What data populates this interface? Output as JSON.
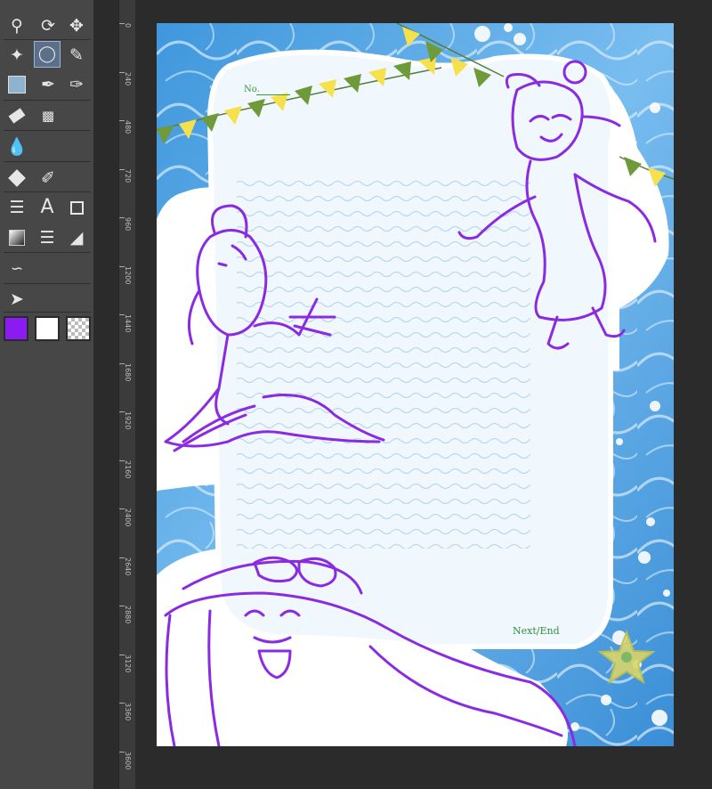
{
  "palette": {
    "tools": [
      {
        "name": "zoom-tool",
        "icon": "magnifier-icon"
      },
      {
        "name": "rotate-tool",
        "icon": "rotate-icon"
      },
      {
        "name": "move-tool",
        "icon": "move-arrows-icon"
      },
      {
        "name": "auto-select-tool",
        "icon": "magic-wand-icon"
      },
      {
        "name": "lasso-select-tool",
        "icon": "lasso-icon",
        "active": true
      },
      {
        "name": "eyedropper-tool",
        "icon": "eyedropper-icon"
      },
      {
        "name": "layer-move-tool",
        "icon": "layer-icon"
      },
      {
        "name": "pen-tool",
        "icon": "dropper-pen-icon"
      },
      {
        "name": "brush-tool",
        "icon": "brush-icon"
      },
      {
        "name": "eraser-tool",
        "icon": "eraser-icon"
      },
      {
        "name": "airbrush-tool",
        "icon": "spray-icon"
      },
      {
        "name": "blend-tool",
        "icon": "drops-icon"
      },
      {
        "name": "fill-tool",
        "icon": "bucket-icon"
      },
      {
        "name": "vector-pen-tool",
        "icon": "nib-icon"
      },
      {
        "name": "figure-tool",
        "icon": "stack-icon"
      },
      {
        "name": "text-tool",
        "icon": "text-icon",
        "label": "A"
      },
      {
        "name": "frame-tool",
        "icon": "rectangle-icon"
      },
      {
        "name": "gradient-tool",
        "icon": "gradient-icon"
      },
      {
        "name": "ruler-tool",
        "icon": "lines-icon"
      },
      {
        "name": "perspective-tool",
        "icon": "triangle-ruler-icon"
      },
      {
        "name": "balloon-tool",
        "icon": "balloon-tail-icon"
      },
      {
        "name": "operation-tool",
        "icon": "select-arrow-icon"
      }
    ],
    "colors": {
      "main": "#8a1cf2",
      "sub": "#ffffff"
    }
  },
  "ruler": {
    "ticks": [
      "0",
      "240",
      "480",
      "720",
      "960",
      "1200",
      "1440",
      "1680",
      "1920",
      "2160",
      "2400",
      "2640",
      "2880",
      "3120",
      "3360",
      "3600"
    ]
  },
  "canvas": {
    "number_label": "No.",
    "next_label": "Next/End",
    "colors": {
      "water": "#5aa8e4",
      "sketch": "#8a2be2",
      "paper": "#f1f8fd",
      "rule": "#c7def0"
    }
  }
}
